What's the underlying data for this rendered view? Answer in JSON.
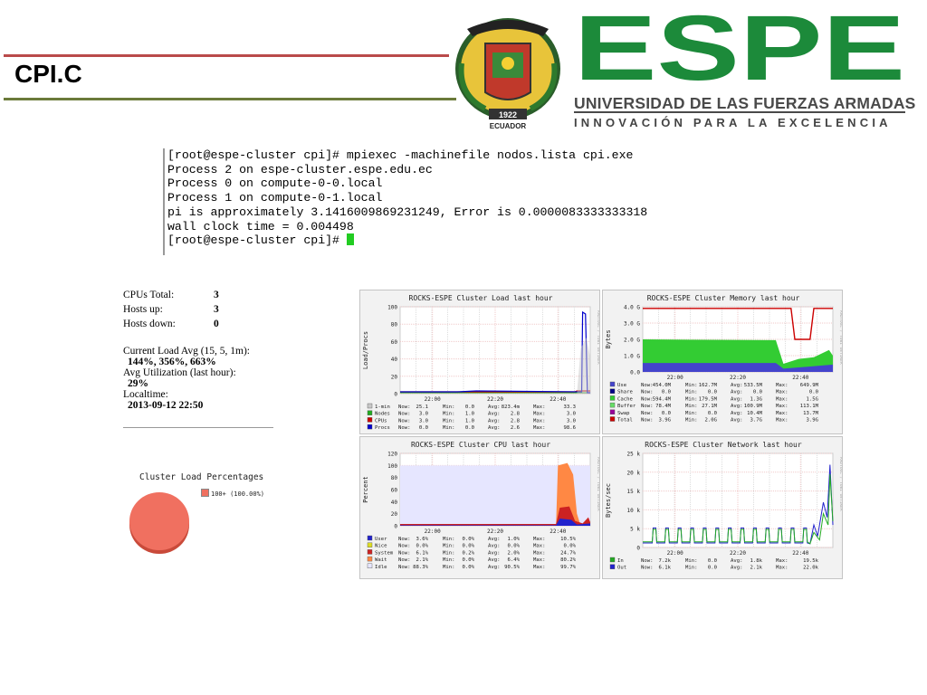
{
  "slide": {
    "title": "CPI.C"
  },
  "logo": {
    "year": "1922",
    "country": "ECUADOR",
    "wordmark": "ESPE",
    "university": "UNIVERSIDAD DE LAS FUERZAS ARMADAS",
    "slogan": "INNOVACIÓN PARA LA EXCELENCIA",
    "colors": {
      "green": "#1c8a3a",
      "gray": "#4a4a4a"
    }
  },
  "terminal": {
    "lines": [
      "[root@espe-cluster cpi]# mpiexec -machinefile nodos.lista cpi.exe",
      "Process 2 on espe-cluster.espe.edu.ec",
      "Process 0 on compute-0-0.local",
      "Process 1 on compute-0-1.local",
      "pi is approximately 3.1416009869231249, Error is 0.0000083333333318",
      "wall clock time = 0.004498",
      "[root@espe-cluster cpi]# "
    ]
  },
  "stats": {
    "cpus_total_label": "CPUs Total:",
    "cpus_total": "3",
    "hosts_up_label": "Hosts up:",
    "hosts_up": "3",
    "hosts_down_label": "Hosts down:",
    "hosts_down": "0",
    "load_label": "Current Load Avg (15, 5, 1m):",
    "load_value": "144%, 356%, 663%",
    "util_label": "Avg Utilization (last hour):",
    "util_value": "29%",
    "localtime_label": "Localtime:",
    "localtime_value": "2013-09-12 22:50"
  },
  "pie": {
    "title": "Cluster Load Percentages",
    "legend": "100+ (100.00%)",
    "color": "#f07060"
  },
  "graphs": {
    "load": {
      "title": "ROCKS-ESPE Cluster Load last hour",
      "ylabel": "Load/Procs",
      "side": "RRDTOOL / TOBI OETIKER",
      "yticks": [
        "100",
        "80",
        "60",
        "40",
        "20",
        "0"
      ],
      "xticks": [
        "22:00",
        "22:20",
        "22:40"
      ],
      "legend": [
        {
          "name": "1-min",
          "color": "#c8c8c8",
          "now": "25.1",
          "min": "0.0",
          "avg": "823.4m",
          "max": "33.3"
        },
        {
          "name": "Nodes",
          "color": "#22aa22",
          "now": "3.0",
          "min": "1.0",
          "avg": "2.8",
          "max": "3.0"
        },
        {
          "name": "CPUs",
          "color": "#cc0000",
          "now": "3.0",
          "min": "1.0",
          "avg": "2.8",
          "max": "3.0"
        },
        {
          "name": "Procs",
          "color": "#0000cc",
          "now": "0.0",
          "min": "0.0",
          "avg": "2.6",
          "max": "98.6"
        }
      ]
    },
    "memory": {
      "title": "ROCKS-ESPE Cluster Memory last hour",
      "ylabel": "Bytes",
      "side": "RRDTOOL / TOBI OETIKER",
      "yticks": [
        "4.0 G",
        "3.0 G",
        "2.0 G",
        "1.0 G",
        "0.0"
      ],
      "xticks": [
        "22:00",
        "22:20",
        "22:40"
      ],
      "legend": [
        {
          "name": "Use",
          "color": "#4444cc",
          "now": "454.0M",
          "min": "162.7M",
          "avg": "533.5M",
          "max": "649.9M"
        },
        {
          "name": "Share",
          "color": "#000088",
          "now": "0.0",
          "min": "0.0",
          "avg": "0.0",
          "max": "0.0"
        },
        {
          "name": "Cache",
          "color": "#33cc33",
          "now": "594.4M",
          "min": "179.5M",
          "avg": "1.3G",
          "max": "1.5G"
        },
        {
          "name": "Buffer",
          "color": "#66dd66",
          "now": "78.4M",
          "min": "27.1M",
          "avg": "100.9M",
          "max": "113.1M"
        },
        {
          "name": "Swap",
          "color": "#990099",
          "now": "0.0",
          "min": "0.0",
          "avg": "10.4M",
          "max": "13.7M"
        },
        {
          "name": "Total",
          "color": "#cc0000",
          "now": "3.9G",
          "min": "2.0G",
          "avg": "3.7G",
          "max": "3.9G"
        }
      ]
    },
    "cpu": {
      "title": "ROCKS-ESPE Cluster CPU last hour",
      "ylabel": "Percent",
      "side": "RRDTOOL / TOBI OETIKER",
      "yticks": [
        "120",
        "100",
        "80",
        "60",
        "40",
        "20",
        "0"
      ],
      "xticks": [
        "22:00",
        "22:20",
        "22:40"
      ],
      "legend": [
        {
          "name": "User",
          "color": "#2222cc",
          "now": "3.6%",
          "min": "0.0%",
          "avg": "1.0%",
          "max": "10.5%"
        },
        {
          "name": "Nice",
          "color": "#dddd22",
          "now": "0.0%",
          "min": "0.0%",
          "avg": "0.0%",
          "max": "0.0%"
        },
        {
          "name": "System",
          "color": "#cc2222",
          "now": "6.1%",
          "min": "0.2%",
          "avg": "2.0%",
          "max": "24.7%"
        },
        {
          "name": "Wait",
          "color": "#ff8844",
          "now": "2.1%",
          "min": "0.0%",
          "avg": "6.4%",
          "max": "80.2%"
        },
        {
          "name": "Idle",
          "color": "#e6e6ff",
          "now": "88.3%",
          "min": "0.0%",
          "avg": "90.5%",
          "max": "99.7%"
        }
      ]
    },
    "network": {
      "title": "ROCKS-ESPE Cluster Network last hour",
      "ylabel": "Bytes/sec",
      "side": "RRDTOOL / TOBI OETIKER",
      "yticks": [
        "25 k",
        "20 k",
        "15 k",
        "10 k",
        "5 k",
        "0"
      ],
      "xticks": [
        "22:00",
        "22:20",
        "22:40"
      ],
      "legend": [
        {
          "name": "In",
          "color": "#22aa22",
          "now": "7.2k",
          "min": "0.0",
          "avg": "1.8k",
          "max": "19.5k"
        },
        {
          "name": "Out",
          "color": "#2222cc",
          "now": "6.1k",
          "min": "0.0",
          "avg": "2.1k",
          "max": "22.0k"
        }
      ]
    },
    "legend_labels": {
      "now": "Now:",
      "min": "Min:",
      "avg": "Avg:",
      "max": "Max:"
    }
  }
}
